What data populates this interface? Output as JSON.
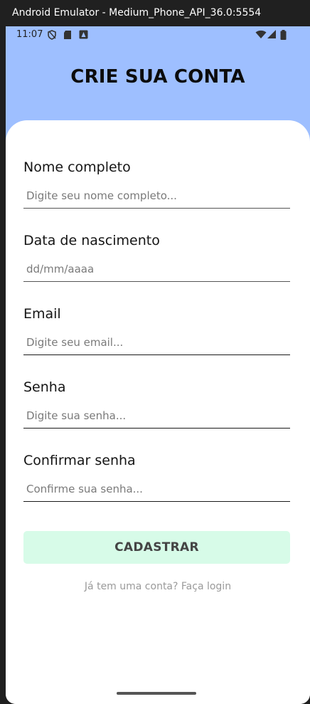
{
  "window": {
    "title": "Android Emulator - Medium_Phone_API_36.0:5554"
  },
  "statusbar": {
    "time": "11:07"
  },
  "header": {
    "title": "CRIE SUA CONTA"
  },
  "form": {
    "fields": [
      {
        "label": "Nome completo",
        "placeholder": "Digite seu nome completo..."
      },
      {
        "label": "Data de nascimento",
        "placeholder": "dd/mm/aaaa"
      },
      {
        "label": "Email",
        "placeholder": "Digite seu email..."
      },
      {
        "label": "Senha",
        "placeholder": "Digite sua senha..."
      },
      {
        "label": "Confirmar senha",
        "placeholder": "Confirme sua senha..."
      }
    ],
    "submit_label": "CADASTRAR",
    "login_link": "Já tem uma conta? Faça login"
  },
  "colors": {
    "header_bg": "#9ebfff",
    "button_bg": "#d7fbe8"
  }
}
